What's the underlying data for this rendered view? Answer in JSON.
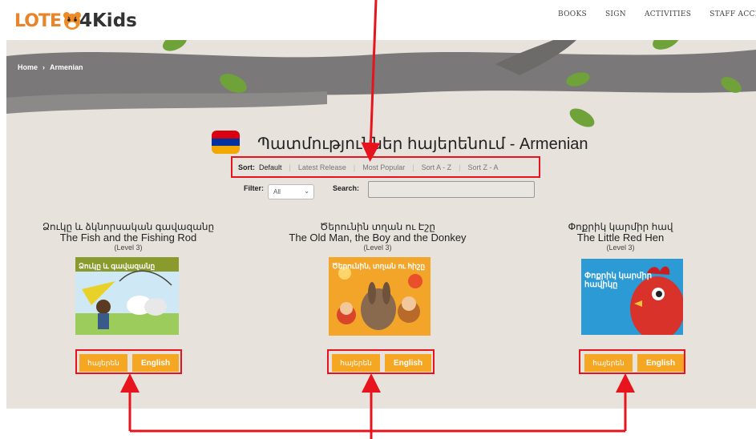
{
  "header": {
    "logo_lote": "LOTE",
    "logo_kids": "4Kids",
    "nav": [
      "BOOKS",
      "SIGN",
      "ACTIVITIES",
      "STAFF ACCES"
    ]
  },
  "breadcrumb": {
    "home": "Home",
    "separator": "›",
    "current": "Armenian"
  },
  "page": {
    "title": "Պատմություններ հայերենում - Armenian",
    "flag_colors": [
      "#d90012",
      "#0033a0",
      "#f2a800"
    ]
  },
  "sort": {
    "label": "Sort:",
    "options": [
      "Default",
      "Latest Release",
      "Most Popular",
      "Sort A - Z",
      "Sort Z - A"
    ]
  },
  "filter": {
    "label": "Filter:",
    "selected": "All",
    "search_label": "Search:",
    "search_value": ""
  },
  "books": [
    {
      "title_native": "Ձուկը և ձկնորսական գավազանը",
      "title_en": "The Fish and the Fishing Rod",
      "level": "(Level 3)",
      "cover_text": "Ձուկը և գավազանը",
      "btn_native": "հայերեն",
      "btn_english": "English"
    },
    {
      "title_native": "Ծերունին տղան ու Էշը",
      "title_en": "The Old Man, the Boy and the Donkey",
      "level": "(Level 3)",
      "cover_text": "Ծերունին, տղան ու հիշը",
      "btn_native": "հայերեն",
      "btn_english": "English"
    },
    {
      "title_native": "Փոքրիկ կարմիր հավ",
      "title_en": "The Little Red Hen",
      "level": "(Level 3)",
      "cover_text": "Փոքրիկ կարմիր հավիկը",
      "btn_native": "հայերեն",
      "btn_english": "English"
    }
  ],
  "colors": {
    "accent": "#f5a623",
    "annotation": "#e8141d",
    "hero_bg": "#e7e2dc"
  }
}
